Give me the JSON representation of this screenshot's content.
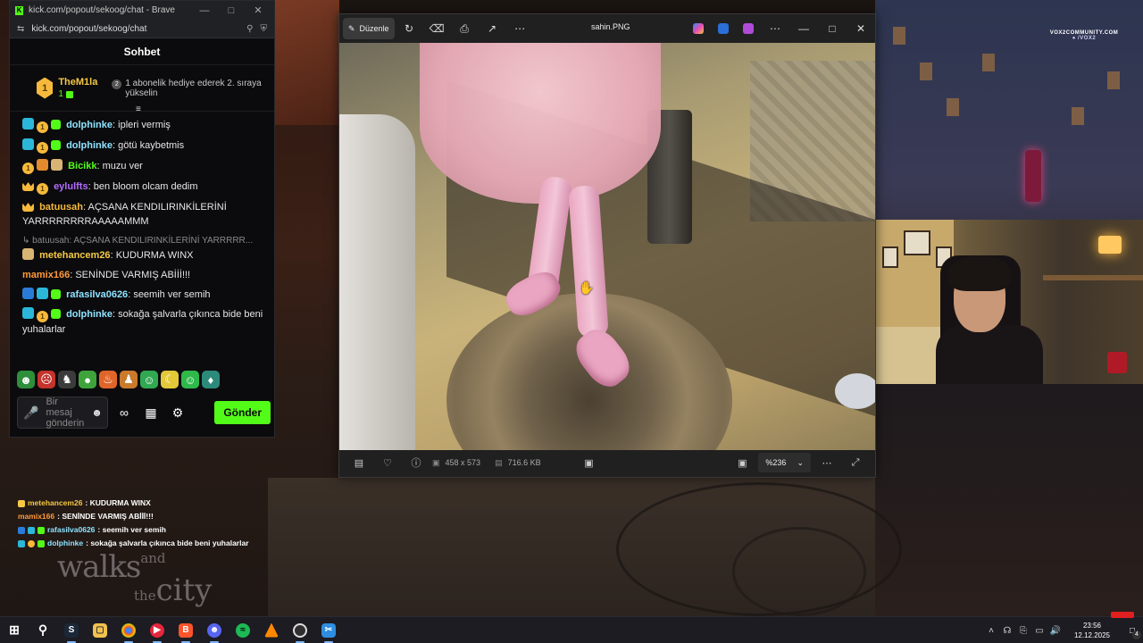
{
  "browser": {
    "title": "kick.com/popout/sekoog/chat - Brave",
    "url": "kick.com/popout/sekoog/chat"
  },
  "chat": {
    "header": "Sohbet",
    "pinned": {
      "rank": "1",
      "username": "TheM1la",
      "gift_count": "1",
      "position_badge": "2",
      "message": "1 abonelik hediye ederek 2. sıraya yükselin"
    },
    "messages": [
      {
        "user": "dolphinke",
        "color": "#8fe3ff",
        "text": "ipleri vermiş"
      },
      {
        "user": "dolphinke",
        "color": "#8fe3ff",
        "text": "götü kaybetmis"
      },
      {
        "user": "Bicikk",
        "color": "#53fc18",
        "text": "muzu ver"
      },
      {
        "user": "eylulfts",
        "color": "#b36cff",
        "text": "ben bloom olcam dedim"
      },
      {
        "user": "batuusah",
        "color": "#f6b93b",
        "text": "AÇSANA KENDILIRINKİLERİNİ YARRRRRRRRAAAAAMMM"
      },
      {
        "user": "metehancem26",
        "color": "#f6c944",
        "text": "KUDURMA WINX"
      },
      {
        "user": "mamix166",
        "color": "#ff9a3c",
        "text": "SENİNDE VARMIŞ ABİİİ!!!"
      },
      {
        "user": "rafasilva0626",
        "color": "#8fe3ff",
        "text": "seemih ver semih"
      },
      {
        "user": "dolphinke",
        "color": "#8fe3ff",
        "text": "sokağa şalvarla çıkınca bide beni yuhalarlar"
      }
    ],
    "reply_line": "batuusah: AÇSANA KENDILIRINKİLERİNİ YARRRRR...",
    "input_placeholder": "Bir mesaj gönderin",
    "send_label": "Gönder"
  },
  "overlay": {
    "vox_line1": "VOX2COMMUNITY.COM",
    "vox_line2": "/VOX2",
    "chat_lines": [
      {
        "user": "metehancem26",
        "color": "#f6c944",
        "text": ": KUDURMA WINX"
      },
      {
        "user": "mamix166",
        "color": "#ff9a3c",
        "text": ": SENİNDE VARMIŞ ABİİİ!!!"
      },
      {
        "user": "rafasilva0626",
        "color": "#8fe3ff",
        "text": ": seemih ver semih"
      },
      {
        "user": "dolphinke",
        "color": "#8fe3ff",
        "text": ": sokağa şalvarla çıkınca bide beni yuhalarlar"
      }
    ],
    "watermark_walks": "walks",
    "watermark_and": "and",
    "watermark_the": "the",
    "watermark_city": "city"
  },
  "photo_viewer": {
    "edit_label": "Düzenle",
    "filename": "sahin.PNG",
    "dimensions": "458 x 573",
    "file_size": "716.6 KB",
    "zoom": "%236"
  },
  "taskbar": {
    "time": "23:56",
    "date": "12.12.2025",
    "notifications": "4",
    "apps": [
      "windows-start",
      "search",
      "steam",
      "file-explorer",
      "chrome",
      "media-player",
      "brave",
      "discord",
      "spotify",
      "vlc",
      "obs",
      "snipping-tool"
    ]
  },
  "colors": {
    "kick_green": "#53fc18",
    "chat_bg": "#0b0b0d"
  }
}
